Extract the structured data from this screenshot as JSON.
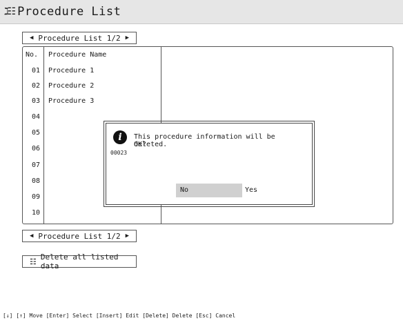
{
  "window": {
    "icon": "procedure-list-icon",
    "icon_glyph": "ℷ☷",
    "title": "Procedure List"
  },
  "pager_top": {
    "prev_glyph": "◀",
    "label": "Procedure List 1/2",
    "next_glyph": "▶"
  },
  "pager_bottom": {
    "prev_glyph": "◀",
    "label": "Procedure List 1/2",
    "next_glyph": "▶"
  },
  "table": {
    "headers": {
      "no": "No.",
      "name": "Procedure Name"
    },
    "rows": [
      {
        "no": "01",
        "name": "Procedure 1"
      },
      {
        "no": "02",
        "name": "Procedure 2"
      },
      {
        "no": "03",
        "name": "Procedure 3"
      },
      {
        "no": "04",
        "name": ""
      },
      {
        "no": "05",
        "name": ""
      },
      {
        "no": "06",
        "name": ""
      },
      {
        "no": "07",
        "name": ""
      },
      {
        "no": "08",
        "name": ""
      },
      {
        "no": "09",
        "name": ""
      },
      {
        "no": "10",
        "name": ""
      }
    ]
  },
  "dialog": {
    "icon": "info-icon",
    "icon_glyph": "i",
    "message_line1": "This procedure information will be deleted.",
    "message_line2": "OK?",
    "code": "00023",
    "no_label": "No",
    "yes_label": "Yes"
  },
  "delete_all": {
    "icon": "list-icon",
    "icon_glyph": "☷",
    "label": "Delete all listed data"
  },
  "footer": {
    "help": "[↓] [↑] Move  [Enter] Select  [Insert] Edit  [Delete] Delete  [Esc] Cancel"
  }
}
